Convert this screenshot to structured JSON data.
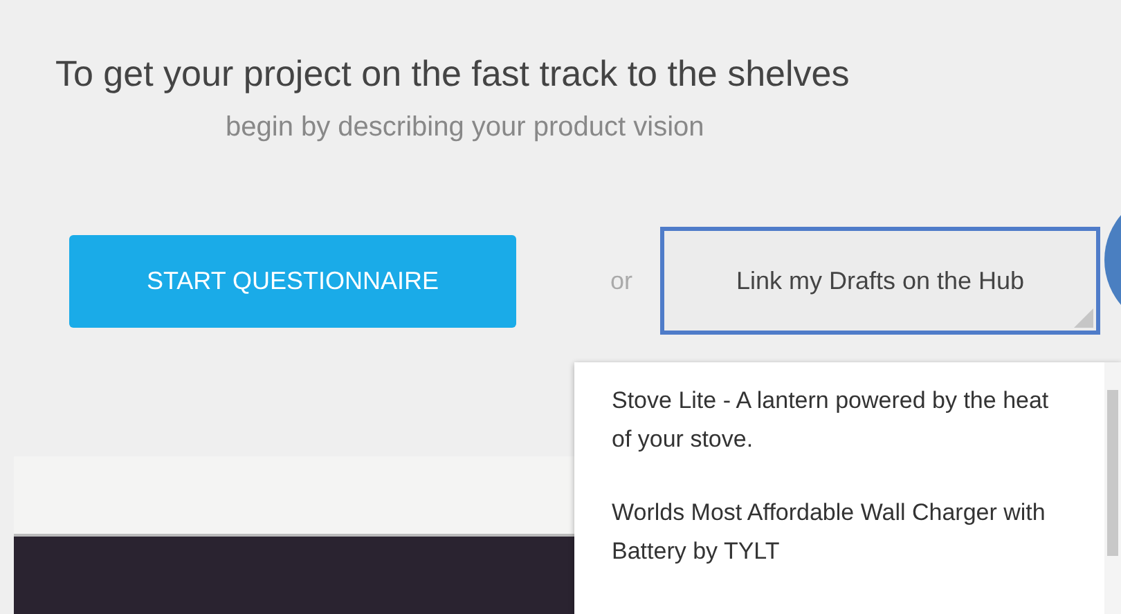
{
  "heading": "To get your project on the fast track to the shelves",
  "subheading": "begin by describing your product vision",
  "start_button": "START QUESTIONNAIRE",
  "separator": "or",
  "drafts_button": "Link my Drafts on the Hub",
  "drafts_menu": [
    {
      "label": "Stove Lite - A lantern powered by the heat of your stove."
    },
    {
      "label": "Worlds Most Affordable Wall Charger with Battery by TYLT"
    }
  ]
}
